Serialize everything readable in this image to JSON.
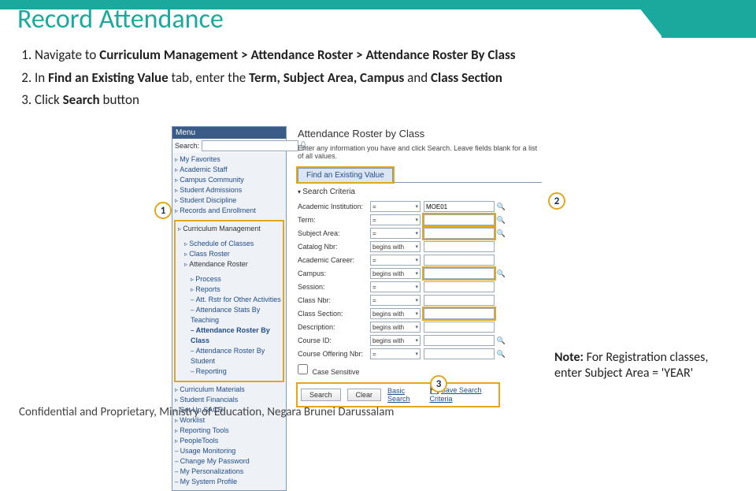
{
  "header": {
    "title": "Record Attendance"
  },
  "steps": {
    "s1a": "Navigate to ",
    "s1b": "Curriculum Management > Attendance Roster > Attendance Roster By Class",
    "s2a": "In ",
    "s2b": "Find an Existing Value",
    "s2c": " tab, enter the ",
    "s2d": "Term, Subject Area, Campus",
    "s2e": " and ",
    "s2f": "Class Section",
    "s3a": "Click ",
    "s3b": "Search",
    "s3c": " button"
  },
  "menu": {
    "header": "Menu",
    "searchLabel": "Search:",
    "top": [
      "My Favorites",
      "Academic Staff",
      "Campus Community",
      "Student Admissions",
      "Student Discipline",
      "Records and Enrollment"
    ],
    "section": {
      "root": "Curriculum Management",
      "items": [
        "Schedule of Classes",
        "Class Roster"
      ],
      "attend": "Attendance Roster",
      "sub": [
        "Process",
        "Reports",
        "Att. Rstr for Other Activities",
        "Attendance Stats By Teaching"
      ],
      "current": "Attendance Roster By Class",
      "after": [
        "Attendance Roster By Student",
        "Reporting"
      ]
    },
    "bottom": [
      "Curriculum Materials",
      "Student Financials",
      "Set Up SACR",
      "Worklist",
      "Reporting Tools",
      "PeopleTools",
      "Usage Monitoring",
      "Change My Password",
      "My Personalizations",
      "My System Profile"
    ]
  },
  "page": {
    "title": "Attendance Roster by Class",
    "sub": "Enter any information you have and click Search. Leave fields blank for a list of all values.",
    "tab": "Find an Existing Value",
    "criteriaHdr": "Search Criteria",
    "rows": [
      {
        "label": "Academic Institution:",
        "op": "=",
        "val": "MOE01",
        "mag": true,
        "hl": false
      },
      {
        "label": "Term:",
        "op": "=",
        "val": "",
        "mag": true,
        "hl": true
      },
      {
        "label": "Subject Area:",
        "op": "=",
        "val": "",
        "mag": true,
        "hl": true
      },
      {
        "label": "Catalog Nbr:",
        "op": "begins with",
        "val": "",
        "mag": false,
        "hl": false
      },
      {
        "label": "Academic Career:",
        "op": "=",
        "val": "",
        "mag": false,
        "hl": false
      },
      {
        "label": "Campus:",
        "op": "begins with",
        "val": "",
        "mag": true,
        "hl": true
      },
      {
        "label": "Session:",
        "op": "=",
        "val": "",
        "mag": false,
        "hl": false
      },
      {
        "label": "Class Nbr:",
        "op": "=",
        "val": "",
        "mag": false,
        "hl": false
      },
      {
        "label": "Class Section:",
        "op": "begins with",
        "val": "",
        "mag": false,
        "hl": true
      },
      {
        "label": "Description:",
        "op": "begins with",
        "val": "",
        "mag": false,
        "hl": false
      },
      {
        "label": "Course ID:",
        "op": "begins with",
        "val": "",
        "mag": true,
        "hl": false
      },
      {
        "label": "Course Offering Nbr:",
        "op": "=",
        "val": "",
        "mag": true,
        "hl": false
      }
    ],
    "case": "Case Sensitive",
    "search": "Search",
    "clear": "Clear",
    "basic": "Basic Search",
    "save": "Save Search Criteria"
  },
  "callouts": {
    "c1": "1",
    "c2": "2",
    "c3": "3"
  },
  "note": {
    "b": "Note:",
    "rest": " For Registration classes, enter Subject Area = 'YEAR'"
  },
  "footer": "Confidential and Proprietary, Ministry of Education, Negara Brunei Darussalam"
}
